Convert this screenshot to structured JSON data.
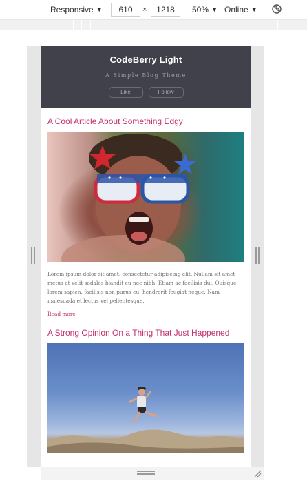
{
  "devtools": {
    "device_mode": "Responsive",
    "width": "610",
    "times": "×",
    "height": "1218",
    "zoom": "50%",
    "network": "Online",
    "rotate_icon": "rotate-icon"
  },
  "site": {
    "title": "CodeBerry Light",
    "tagline": "A Simple Blog Theme",
    "like_label": "Like",
    "follow_label": "Follow"
  },
  "articles": [
    {
      "title": "A Cool Article About Something Edgy",
      "image": "child-with-star-glasses-photo",
      "body": "Lorem ipsum dolor sit amet, consectetur adipiscing elit. Nullam sit amet metus at velit sodales blandit eu nec nibh. Etiam ac facilisis dui. Quisque lorem sapien, facilisis non purus eu, hendrerit feugiat neque. Nam malesuada et lectus vel pellentesque.",
      "read_more": "Read more"
    },
    {
      "title": "A Strong Opinion On a Thing That Just Happened",
      "image": "person-jumping-desert-photo"
    }
  ],
  "colors": {
    "header_bg": "#40414a",
    "accent": "#c2316c"
  }
}
